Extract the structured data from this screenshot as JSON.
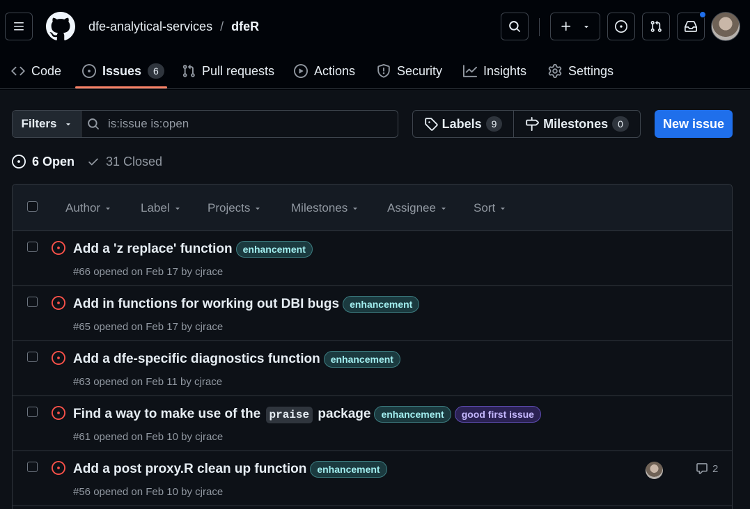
{
  "header": {
    "owner": "dfe-analytical-services",
    "separator": "/",
    "repo": "dfeR"
  },
  "tabs": [
    {
      "label": "Code",
      "icon": "code-icon"
    },
    {
      "label": "Issues",
      "icon": "issue-opened-icon",
      "count": "6"
    },
    {
      "label": "Pull requests",
      "icon": "git-pull-request-icon"
    },
    {
      "label": "Actions",
      "icon": "play-icon"
    },
    {
      "label": "Security",
      "icon": "shield-icon"
    },
    {
      "label": "Insights",
      "icon": "graph-icon"
    },
    {
      "label": "Settings",
      "icon": "gear-icon"
    }
  ],
  "toolbar": {
    "filters_label": "Filters",
    "search_placeholder": "is:issue is:open",
    "labels_label": "Labels",
    "labels_count": "9",
    "milestones_label": "Milestones",
    "milestones_count": "0",
    "new_issue_label": "New issue"
  },
  "state": {
    "open_label": "6 Open",
    "closed_label": "31 Closed"
  },
  "list_header": [
    "Author",
    "Label",
    "Projects",
    "Milestones",
    "Assignee",
    "Sort"
  ],
  "issues": [
    {
      "title": "Add a 'z replace' function",
      "labels": [
        "enhancement"
      ],
      "meta": "#66 opened on Feb 17 by cjrace"
    },
    {
      "title": "Add in functions for working out DBI bugs",
      "labels": [
        "enhancement"
      ],
      "meta": "#65 opened on Feb 17 by cjrace"
    },
    {
      "title": "Add a dfe-specific diagnostics function",
      "labels": [
        "enhancement"
      ],
      "meta": "#63 opened on Feb 11 by cjrace"
    },
    {
      "title_pre": "Find a way to make use of the",
      "title_code": "praise",
      "title_post": "package",
      "labels": [
        "enhancement",
        "good first issue"
      ],
      "meta": "#61 opened on Feb 10 by cjrace"
    },
    {
      "title": "Add a post proxy.R clean up function",
      "labels": [
        "enhancement"
      ],
      "meta": "#56 opened on Feb 10 by cjrace",
      "comments": "2"
    }
  ],
  "colors": {
    "accent": "#1f6feb",
    "open_issue": "#f85149",
    "tab_underline": "#f78166"
  }
}
